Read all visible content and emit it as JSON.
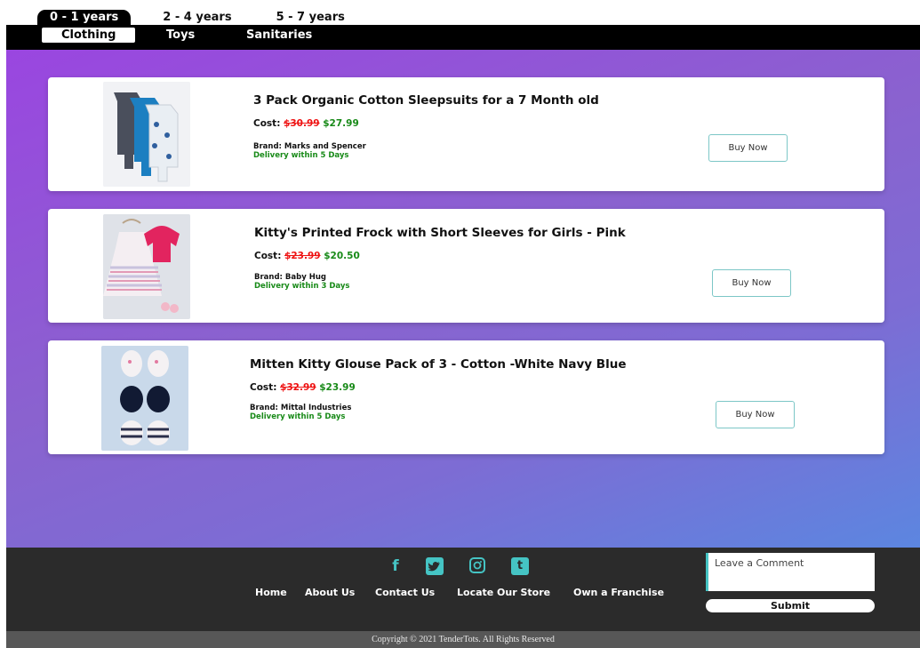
{
  "age_tabs": [
    "0 - 1 years",
    "2 - 4 years",
    "5 - 7 years"
  ],
  "categories": [
    "Clothing",
    "Toys",
    "Sanitaries"
  ],
  "products": [
    {
      "title": "3 Pack Organic Cotton Sleepsuits for a 7 Month old",
      "cost_label": "Cost:",
      "old_price": "$30.99",
      "new_price": "$27.99",
      "brand": "Brand: Marks and Spencer",
      "delivery": "Delivery within 5 Days",
      "button": "Buy Now"
    },
    {
      "title": "Kitty's Printed Frock with Short Sleeves for Girls - Pink",
      "cost_label": "Cost:",
      "old_price": "$23.99",
      "new_price": "$20.50",
      "brand": "Brand: Baby Hug",
      "delivery": "Delivery within 3 Days",
      "button": "Buy Now"
    },
    {
      "title": "Mitten Kitty Glouse Pack of 3 - Cotton -White Navy Blue",
      "cost_label": "Cost:",
      "old_price": "$32.99",
      "new_price": "$23.99",
      "brand": "Brand: Mittal Industries",
      "delivery": "Delivery within 5 Days",
      "button": "Buy Now"
    }
  ],
  "footer": {
    "social_icons": [
      "facebook-icon",
      "twitter-icon",
      "instagram-icon",
      "tumblr-icon"
    ],
    "nav": [
      "Home",
      "About Us",
      "Contact Us",
      "Locate Our Store",
      "Own a Franchise"
    ],
    "comment_placeholder": "Leave a Comment",
    "submit": "Submit",
    "copyright": "Copyright © 2021 TenderTots. All Rights Reserved"
  },
  "colors": {
    "accent": "#45c4c4",
    "price_old": "#e11111",
    "price_new": "#188a18",
    "footer_bg": "#2b2b2b"
  }
}
